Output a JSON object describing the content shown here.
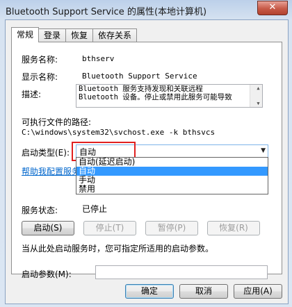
{
  "window": {
    "title": "Bluetooth Support Service 的属性(本地计算机)",
    "close_glyph": "✕"
  },
  "tabs": [
    {
      "label": "常规"
    },
    {
      "label": "登录"
    },
    {
      "label": "恢复"
    },
    {
      "label": "依存关系"
    }
  ],
  "general": {
    "service_name_label": "服务名称:",
    "service_name_value": "bthserv",
    "display_name_label": "显示名称:",
    "display_name_value": "Bluetooth Support Service",
    "description_label": "描述:",
    "description_lines": [
      "Bluetooth 服务支持发现和关联远程",
      "Bluetooth 设备。停止或禁用此服务可能导致"
    ],
    "exe_path_label": "可执行文件的路径:",
    "exe_path_value": "C:\\windows\\system32\\svchost.exe -k bthsvcs",
    "startup_type_label": "启动类型(E):",
    "startup_type_value": "自动",
    "startup_options": [
      "自动(延迟启动)",
      "自动",
      "手动",
      "禁用"
    ],
    "startup_selected_index": 1,
    "help_link": "帮助我配置服务启",
    "service_status_label": "服务状态:",
    "service_status_value": "已停止",
    "start_button": "启动(S)",
    "stop_button": "停止(T)",
    "pause_button": "暂停(P)",
    "resume_button": "恢复(R)",
    "hint_text": "当从此处启动服务时，您可指定所适用的启动参数。",
    "start_params_label": "启动参数(M):",
    "start_params_value": ""
  },
  "footer": {
    "ok_button": "确定",
    "cancel_button": "取消",
    "apply_button": "应用(A)"
  },
  "colors": {
    "selection": "#3399ff",
    "annotation_box": "#e02020",
    "link": "#0066cc"
  }
}
